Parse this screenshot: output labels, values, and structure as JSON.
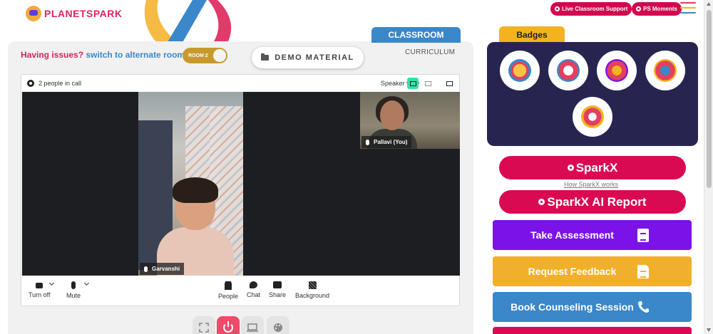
{
  "app": {
    "brand": "PLANETSPARK"
  },
  "header": {
    "live_support_label": "Live Classroom Support",
    "ps_moments_label": "PS Moments"
  },
  "tabs": {
    "classroom": "CLASSROOM",
    "curriculum": "CURRICULUM",
    "badges": "Badges"
  },
  "issues_bar": {
    "prefix": "Having issues?",
    "link": "switch to alternate room",
    "room_toggle": "ROOM 2"
  },
  "demo_material": "DEMO MATERIAL",
  "call": {
    "people_count": "2 people in call",
    "view_mode": "Speaker view",
    "participants": [
      {
        "name": "Garvanshi"
      },
      {
        "name": "Pallavi (You)"
      }
    ],
    "controls": {
      "turn_off": "Turn off",
      "mute": "Mute",
      "people": "People",
      "chat": "Chat",
      "share": "Share",
      "background": "Background"
    }
  },
  "sidebar": {
    "sparkx_label": "SparkX",
    "how_sparkx": "How SparkX works",
    "sparkx_report_label": "SparkX AI Report",
    "take_assessment": "Take Assessment",
    "request_feedback": "Request Feedback",
    "book_counseling": "Book Counseling Session"
  },
  "colors": {
    "brand_red": "#d90a52",
    "brand_blue": "#3a87c9",
    "purple": "#7b12e8",
    "amber": "#f1b02c",
    "badge_panel": "#272550",
    "badge_tab": "#f2b31c"
  }
}
